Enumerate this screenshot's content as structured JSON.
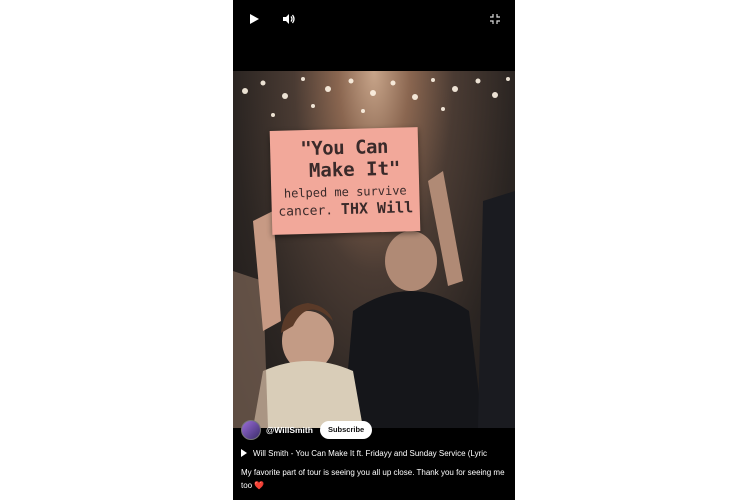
{
  "controls": {
    "play_icon": "play-icon",
    "volume_icon": "volume-icon",
    "fullscreen_icon": "exit-fullscreen-icon"
  },
  "video": {
    "sign_line1": "\"You Can",
    "sign_line2": "Make It\"",
    "sign_line3": "helped me survive",
    "sign_line4a": "cancer.",
    "sign_line4b": "THX Will"
  },
  "channel": {
    "handle": "@WillSmith",
    "subscribe_label": "Subscribe"
  },
  "song": {
    "title": "Will Smith - You Can Make It ft. Fridayy and Sunday Service (Lyric"
  },
  "caption": {
    "text": "My favorite part of tour is seeing you all up close. Thank you for seeing me too",
    "emoji": "❤️"
  },
  "colors": {
    "player_bg": "#000000",
    "page_bg": "#ffffff",
    "sign": "#f2a89a"
  }
}
